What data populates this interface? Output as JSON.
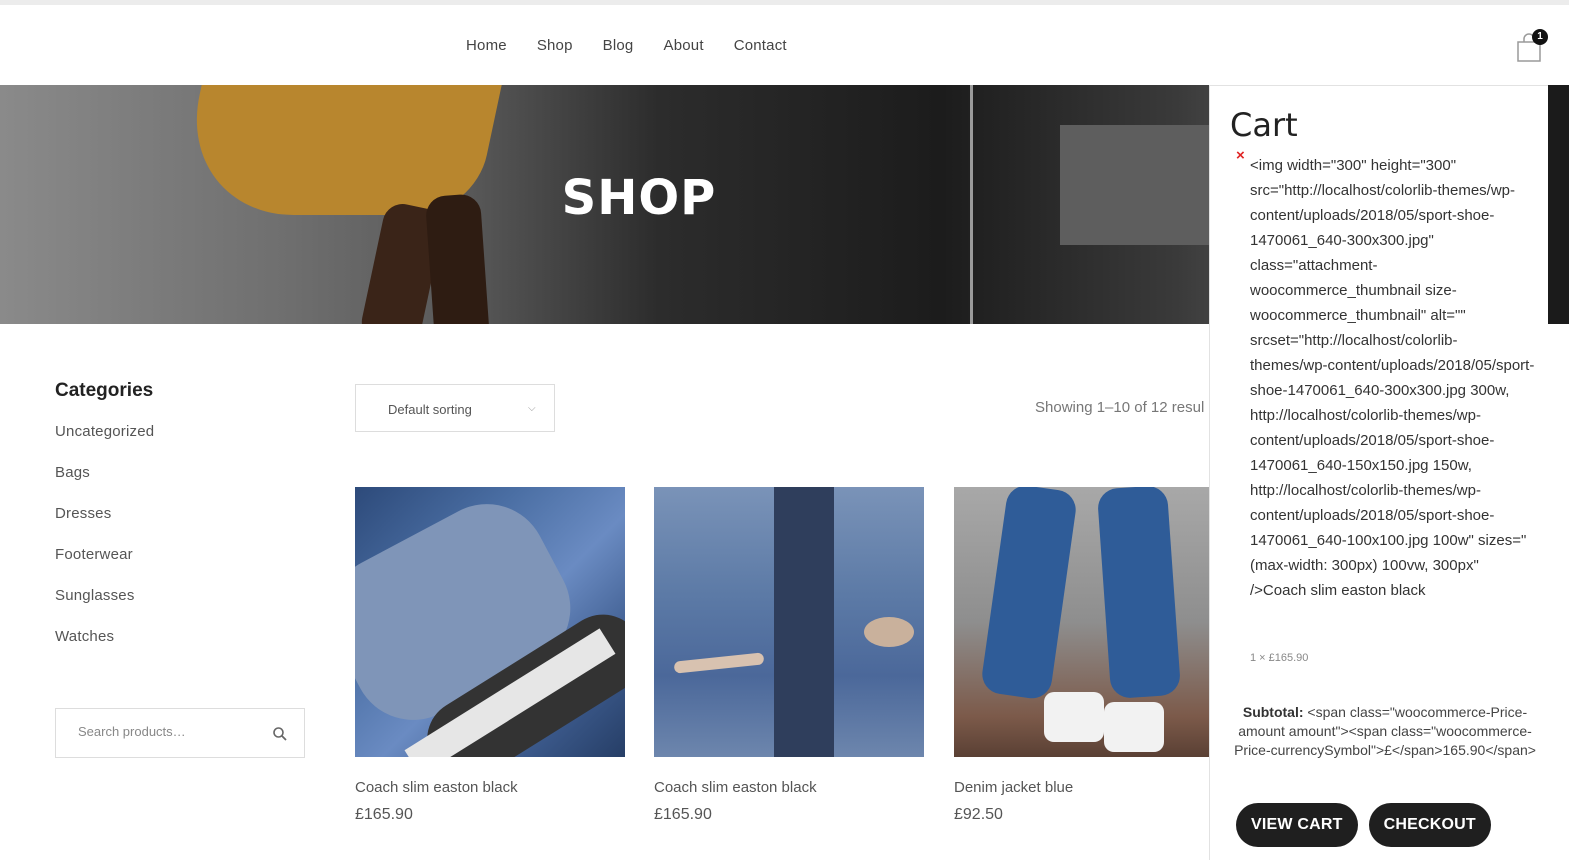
{
  "nav": {
    "items": [
      "Home",
      "Shop",
      "Blog",
      "About",
      "Contact"
    ]
  },
  "cart_icon": {
    "icon": "shopping-bag-icon",
    "count": "1"
  },
  "hero": {
    "title": "SHOP"
  },
  "sidebar": {
    "categories_title": "Categories",
    "categories": [
      "Uncategorized",
      "Bags",
      "Dresses",
      "Footerwear",
      "Sunglasses",
      "Watches"
    ],
    "search": {
      "placeholder": "Search products…",
      "icon": "search-icon"
    }
  },
  "toolbar": {
    "sorting_label": "Default sorting",
    "results_text": "Showing 1–10 of 12 resul"
  },
  "products": [
    {
      "name": "Coach slim easton black",
      "price": "£165.90"
    },
    {
      "name": "Coach slim easton black",
      "price": "£165.90"
    },
    {
      "name": "Denim jacket blue",
      "price": "£92.50"
    }
  ],
  "cart": {
    "title": "Cart",
    "remove_symbol": "×",
    "item_text": "<img width=\"300\" height=\"300\" src=\"http://localhost/colorlib-themes/wp-content/uploads/2018/05/sport-shoe-1470061_640-300x300.jpg\" class=\"attachment-woocommerce_thumbnail size-woocommerce_thumbnail\" alt=\"\" srcset=\"http://localhost/colorlib-themes/wp-content/uploads/2018/05/sport-shoe-1470061_640-300x300.jpg 300w, http://localhost/colorlib-themes/wp-content/uploads/2018/05/sport-shoe-1470061_640-150x150.jpg 150w, http://localhost/colorlib-themes/wp-content/uploads/2018/05/sport-shoe-1470061_640-100x100.jpg 100w\" sizes=\"(max-width: 300px) 100vw, 300px\" />Coach slim easton black",
    "item_qty": "1 × £165.90",
    "subtotal_label": "Subtotal:",
    "subtotal_value": "<span class=\"woocommerce-Price-amount amount\"><span class=\"woocommerce-Price-currencySymbol\">£</span>165.90</span>",
    "view_cart": "VIEW CART",
    "checkout": "CHECKOUT"
  },
  "colors": {
    "accent_dark": "#1f1f1f",
    "remove_red": "#e02424"
  }
}
